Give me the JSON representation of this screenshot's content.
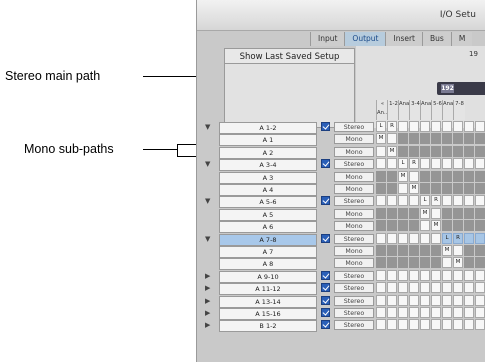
{
  "callouts": {
    "stereo_main_path": "Stereo main path",
    "mono_sub_paths": "Mono sub-paths"
  },
  "window": {
    "title": "I/O Setu",
    "tabs": [
      "Input",
      "Output",
      "Insert",
      "Bus",
      "M"
    ],
    "active_tab": "Output",
    "show_last_saved": "Show Last Saved Setup",
    "sample_rate_label": "19",
    "display_value": "192"
  },
  "column_headers": [
    [
      "« An...",
      "1-2"
    ],
    [
      "Analog",
      "3-4"
    ],
    [
      "Analog",
      "5-6"
    ],
    [
      "Analo",
      "7-8"
    ]
  ],
  "paths": [
    {
      "name": "A 1-2",
      "format": "Stereo",
      "expandable": true,
      "expanded": true,
      "checked": true,
      "selected": false
    },
    {
      "name": "A 1",
      "format": "Mono",
      "expandable": false,
      "checked": false,
      "selected": false
    },
    {
      "name": "A 2",
      "format": "Mono",
      "expandable": false,
      "checked": false,
      "selected": false
    },
    {
      "name": "A 3-4",
      "format": "Stereo",
      "expandable": true,
      "expanded": true,
      "checked": true,
      "selected": false
    },
    {
      "name": "A 3",
      "format": "Mono",
      "expandable": false,
      "checked": false,
      "selected": false
    },
    {
      "name": "A 4",
      "format": "Mono",
      "expandable": false,
      "checked": false,
      "selected": false
    },
    {
      "name": "A 5-6",
      "format": "Stereo",
      "expandable": true,
      "expanded": true,
      "checked": true,
      "selected": false
    },
    {
      "name": "A 5",
      "format": "Mono",
      "expandable": false,
      "checked": false,
      "selected": false
    },
    {
      "name": "A 6",
      "format": "Mono",
      "expandable": false,
      "checked": false,
      "selected": false
    },
    {
      "name": "A 7-8",
      "format": "Stereo",
      "expandable": true,
      "expanded": true,
      "checked": true,
      "selected": true
    },
    {
      "name": "A 7",
      "format": "Mono",
      "expandable": false,
      "checked": false,
      "selected": false
    },
    {
      "name": "A 8",
      "format": "Mono",
      "expandable": false,
      "checked": false,
      "selected": false
    },
    {
      "name": "A 9-10",
      "format": "Stereo",
      "expandable": true,
      "expanded": false,
      "checked": true,
      "selected": false
    },
    {
      "name": "A 11-12",
      "format": "Stereo",
      "expandable": true,
      "expanded": false,
      "checked": true,
      "selected": false
    },
    {
      "name": "A 13-14",
      "format": "Stereo",
      "expandable": true,
      "expanded": false,
      "checked": true,
      "selected": false
    },
    {
      "name": "A 15-16",
      "format": "Stereo",
      "expandable": true,
      "expanded": false,
      "checked": true,
      "selected": false
    },
    {
      "name": "B 1-2",
      "format": "Stereo",
      "expandable": true,
      "expanded": false,
      "checked": true,
      "selected": false
    }
  ],
  "grid": {
    "num_cols": 10,
    "rows": [
      {
        "cells": {
          "0": "L",
          "1": "R"
        },
        "dark": []
      },
      {
        "cells": {
          "0": "M"
        },
        "dark": [
          2,
          3,
          4,
          5,
          6,
          7,
          8,
          9
        ]
      },
      {
        "cells": {
          "1": "M"
        },
        "dark": [
          2,
          3,
          4,
          5,
          6,
          7,
          8,
          9
        ]
      },
      {
        "cells": {
          "2": "L",
          "3": "R"
        },
        "dark": []
      },
      {
        "cells": {
          "2": "M"
        },
        "dark": [
          0,
          1,
          4,
          5,
          6,
          7,
          8,
          9
        ]
      },
      {
        "cells": {
          "3": "M"
        },
        "dark": [
          0,
          1,
          4,
          5,
          6,
          7,
          8,
          9
        ]
      },
      {
        "cells": {
          "4": "L",
          "5": "R"
        },
        "dark": []
      },
      {
        "cells": {
          "4": "M"
        },
        "dark": [
          0,
          1,
          2,
          3,
          6,
          7,
          8,
          9
        ]
      },
      {
        "cells": {
          "5": "M"
        },
        "dark": [
          0,
          1,
          2,
          3,
          6,
          7,
          8,
          9
        ]
      },
      {
        "cells": {
          "6": "L",
          "7": "R"
        },
        "dark": [],
        "blue": [
          6,
          7,
          8,
          9
        ]
      },
      {
        "cells": {
          "6": "M"
        },
        "dark": [
          0,
          1,
          2,
          3,
          4,
          5,
          8,
          9
        ]
      },
      {
        "cells": {
          "7": "M"
        },
        "dark": [
          0,
          1,
          2,
          3,
          4,
          5,
          8,
          9
        ]
      },
      {
        "cells": {},
        "dark": []
      },
      {
        "cells": {},
        "dark": []
      },
      {
        "cells": {},
        "dark": []
      },
      {
        "cells": {},
        "dark": []
      },
      {
        "cells": {},
        "dark": []
      }
    ]
  }
}
